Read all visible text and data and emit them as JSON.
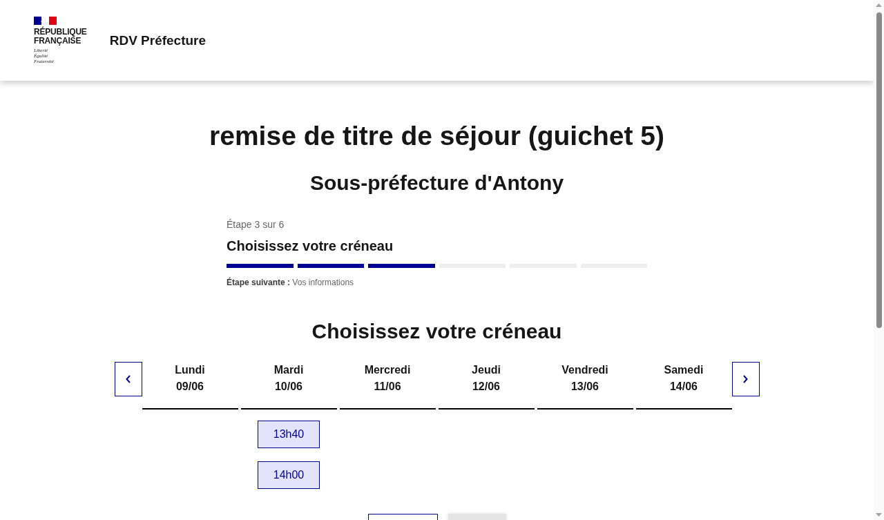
{
  "header": {
    "logo_text": "RÉPUBLIQUE FRANÇAISE",
    "motto": "Liberté Égalité Fraternité",
    "site_name": "RDV Préfecture"
  },
  "page": {
    "title": "remise de titre de séjour (guichet 5)",
    "subtitle": "Sous-préfecture d'Antony"
  },
  "stepper": {
    "step_label": "Étape 3 sur 6",
    "title": "Choisissez votre créneau",
    "segments": [
      {
        "done": true
      },
      {
        "done": true
      },
      {
        "done": true
      },
      {
        "done": false
      },
      {
        "done": false
      },
      {
        "done": false
      }
    ],
    "next_step": "**Étape suivante :** Vos informations"
  },
  "calendar": {
    "title": "Choisissez votre créneau",
    "days": [
      {
        "name": "Lundi",
        "date": "09/06"
      },
      {
        "name": "Mardi",
        "date": "10/06",
        "slots": [
          "13h40",
          "14h00"
        ]
      },
      {
        "name": "Mercredi",
        "date": "11/06"
      },
      {
        "name": "Jeudi",
        "date": "12/06"
      },
      {
        "name": "Vendredi",
        "date": "13/06"
      },
      {
        "name": "Samedi",
        "date": "14/06"
      }
    ]
  },
  "bottom_buttons": [
    {
      "disabled": false
    },
    {
      "disabled": true
    }
  ]
}
